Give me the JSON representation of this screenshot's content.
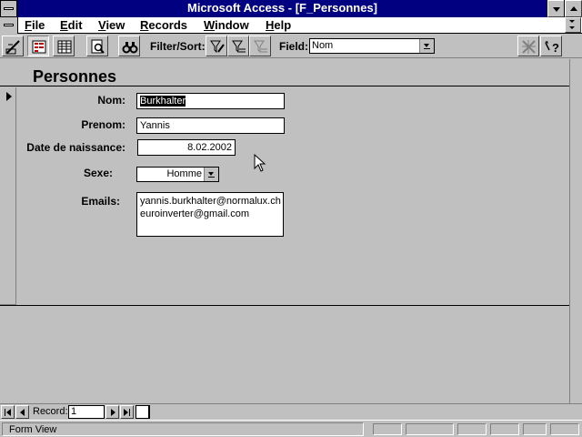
{
  "window": {
    "title": "Microsoft Access - [F_Personnes]"
  },
  "menu": {
    "items": [
      "File",
      "Edit",
      "View",
      "Records",
      "Window",
      "Help"
    ]
  },
  "toolbar": {
    "filter_sort_label": "Filter/Sort:",
    "field_label": "Field:",
    "field_value": "Nom",
    "icons": [
      "design-view-icon",
      "form-view-icon",
      "datasheet-view-icon",
      "print-preview-icon",
      "find-icon",
      "edit-filter-icon",
      "apply-filter-icon",
      "show-all-records-icon",
      "build-icon",
      "help-icon"
    ]
  },
  "form": {
    "title": "Personnes",
    "fields": {
      "nom": {
        "label": "Nom:",
        "value": "Burkhalter"
      },
      "prenom": {
        "label": "Prenom:",
        "value": "Yannis"
      },
      "date_naissance": {
        "label": "Date de naissance:",
        "value": "8.02.2002"
      },
      "sexe": {
        "label": "Sexe:",
        "value": "Homme"
      },
      "emails": {
        "label": "Emails:",
        "lines": [
          "yannis.burkhalter@normalux.ch",
          "euroinverter@gmail.com"
        ]
      }
    }
  },
  "navigation": {
    "record_label": "Record:",
    "record_number": "1"
  },
  "status": {
    "text": "Form View"
  }
}
